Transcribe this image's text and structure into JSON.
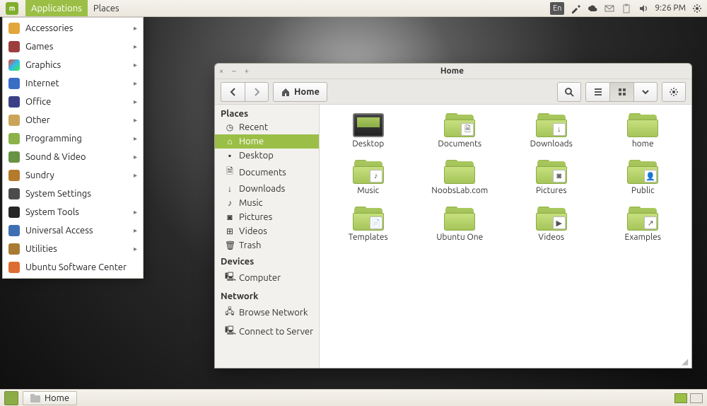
{
  "top_panel": {
    "applications_label": "Applications",
    "places_label": "Places",
    "lang_indicator": "En",
    "time": "9:26 PM"
  },
  "app_menu": {
    "items": [
      {
        "label": "Accessories",
        "icon": "mic-accessories",
        "arrow": true
      },
      {
        "label": "Games",
        "icon": "mic-games",
        "arrow": true
      },
      {
        "label": "Graphics",
        "icon": "mic-graphics",
        "arrow": true
      },
      {
        "label": "Internet",
        "icon": "mic-internet",
        "arrow": true
      },
      {
        "label": "Office",
        "icon": "mic-office",
        "arrow": true
      },
      {
        "label": "Other",
        "icon": "mic-other",
        "arrow": true
      },
      {
        "label": "Programming",
        "icon": "mic-programming",
        "arrow": true
      },
      {
        "label": "Sound & Video",
        "icon": "mic-sound",
        "arrow": true
      },
      {
        "label": "Sundry",
        "icon": "mic-sundry",
        "arrow": true
      },
      {
        "label": "System Settings",
        "icon": "mic-settings",
        "arrow": false
      },
      {
        "label": "System Tools",
        "icon": "mic-tools",
        "arrow": true
      },
      {
        "label": "Universal Access",
        "icon": "mic-ua",
        "arrow": true
      },
      {
        "label": "Utilities",
        "icon": "mic-util",
        "arrow": true
      },
      {
        "label": "Ubuntu Software Center",
        "icon": "mic-usc",
        "arrow": false
      }
    ]
  },
  "file_manager": {
    "title": "Home",
    "path_button": "Home",
    "sidebar": {
      "places_header": "Places",
      "devices_header": "Devices",
      "network_header": "Network",
      "places": [
        {
          "label": "Recent",
          "icon": "◷"
        },
        {
          "label": "Home",
          "icon": "⌂",
          "selected": true
        },
        {
          "label": "Desktop",
          "icon": "▪"
        },
        {
          "label": "Documents",
          "icon": "🗎"
        },
        {
          "label": "Downloads",
          "icon": "↓"
        },
        {
          "label": "Music",
          "icon": "♪"
        },
        {
          "label": "Pictures",
          "icon": "◙"
        },
        {
          "label": "Videos",
          "icon": "⊞"
        },
        {
          "label": "Trash",
          "icon": "🗑"
        }
      ],
      "devices": [
        {
          "label": "Computer",
          "icon": "🖳"
        }
      ],
      "network": [
        {
          "label": "Browse Network",
          "icon": "🖧"
        },
        {
          "label": "Connect to Server",
          "icon": "🖳"
        }
      ]
    },
    "folders": [
      {
        "label": "Desktop",
        "type": "desktop"
      },
      {
        "label": "Documents",
        "type": "folder",
        "emblem": "🗎"
      },
      {
        "label": "Downloads",
        "type": "folder",
        "emblem": "↓"
      },
      {
        "label": "home",
        "type": "folder"
      },
      {
        "label": "Music",
        "type": "folder",
        "emblem": "♪"
      },
      {
        "label": "NoobsLab.com",
        "type": "folder"
      },
      {
        "label": "Pictures",
        "type": "folder",
        "emblem": "◙"
      },
      {
        "label": "Public",
        "type": "folder",
        "emblem": "👤"
      },
      {
        "label": "Templates",
        "type": "folder",
        "emblem": "📄"
      },
      {
        "label": "Ubuntu One",
        "type": "folder"
      },
      {
        "label": "Videos",
        "type": "folder",
        "emblem": "▶"
      },
      {
        "label": "Examples",
        "type": "folder",
        "emblem": "↗"
      }
    ]
  },
  "bottom_panel": {
    "task_label": "Home"
  }
}
